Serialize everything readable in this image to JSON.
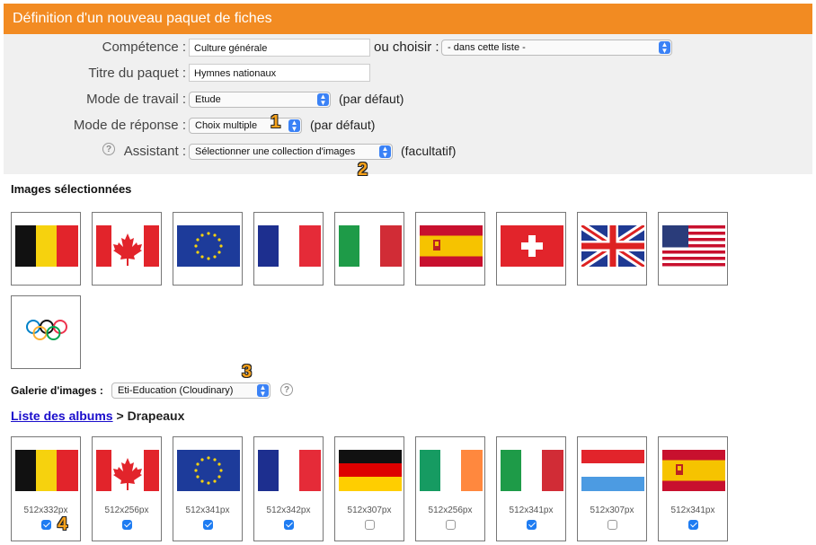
{
  "header": {
    "title": "Définition d'un nouveau paquet de fiches"
  },
  "form": {
    "competence": {
      "label": "Compétence :",
      "value": "Culture générale",
      "or_choose": "ou choisir :",
      "select_value": "- dans cette liste -"
    },
    "titre": {
      "label": "Titre du paquet :",
      "value": "Hymnes nationaux"
    },
    "mode_travail": {
      "label": "Mode de travail :",
      "value": "Etude",
      "note": "(par défaut)"
    },
    "mode_reponse": {
      "label": "Mode de réponse :",
      "value": "Choix multiple",
      "note": "(par défaut)"
    },
    "assistant": {
      "label": "Assistant :",
      "value": "Sélectionner une collection d'images",
      "note": "(facultatif)"
    }
  },
  "badges": [
    "1",
    "2",
    "3",
    "4"
  ],
  "selected": {
    "title": "Images sélectionnées",
    "flags": [
      "belgium-flag",
      "canada-flag",
      "eu-flag",
      "france-flag",
      "italy-flag",
      "spain-flag",
      "switzerland-flag",
      "uk-flag",
      "usa-flag",
      "olympic-flag"
    ]
  },
  "gallery": {
    "label": "Galerie d'images :",
    "select_value": "Eti-Education (Cloudinary)",
    "breadcrumb_link": "Liste des albums",
    "breadcrumb_sep": ">",
    "breadcrumb_current": "Drapeaux",
    "items": [
      {
        "flag": "belgium-flag",
        "size": "512x332px",
        "checked": true
      },
      {
        "flag": "canada-flag",
        "size": "512x256px",
        "checked": true
      },
      {
        "flag": "eu-flag",
        "size": "512x341px",
        "checked": true
      },
      {
        "flag": "france-flag",
        "size": "512x342px",
        "checked": true
      },
      {
        "flag": "germany-flag",
        "size": "512x307px",
        "checked": false
      },
      {
        "flag": "ireland-flag",
        "size": "512x256px",
        "checked": false
      },
      {
        "flag": "italy-flag",
        "size": "512x341px",
        "checked": true
      },
      {
        "flag": "netherlands-flag",
        "size": "512x307px",
        "checked": false
      },
      {
        "flag": "spain-flag",
        "size": "512x341px",
        "checked": true
      }
    ]
  },
  "colors": {
    "header": "#f28b22",
    "badge": "#f7a21b",
    "checkbox": "#1e7cf2",
    "select_arrow": "#3b82f6"
  }
}
